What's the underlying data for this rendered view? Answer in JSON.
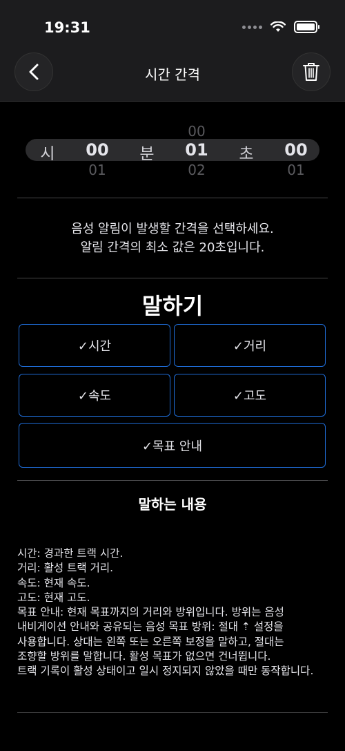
{
  "status_bar": {
    "time": "19:31"
  },
  "nav": {
    "title": "시간 간격"
  },
  "picker": {
    "hours": {
      "above": "",
      "value": "00",
      "below": "01",
      "unit": "시"
    },
    "minutes": {
      "above": "00",
      "value": "01",
      "below": "02",
      "unit": "분"
    },
    "seconds": {
      "above": "",
      "value": "00",
      "below": "01",
      "unit": "초"
    }
  },
  "description": {
    "line1": "음성 알림이 발생할 간격을 선택하세요.",
    "line2": "알림 간격의 최소 값은 20초입니다."
  },
  "speak": {
    "title": "말하기",
    "options": {
      "time": "✓시간",
      "distance": "✓거리",
      "speed": "✓속도",
      "altitude": "✓고도",
      "target": "✓목표 안내"
    }
  },
  "content": {
    "title": "말하는 내용",
    "lines": [
      "시간: 경과한 트랙 시간.",
      "거리: 활성 트랙 거리.",
      "속도: 현재 속도.",
      "고도: 현재 고도.",
      "목표 안내: 현재 목표까지의 거리와 방위입니다. 방위는 음성",
      "내비게이션 안내와 공유되는 음성 목표 방위: 절대 ⇡ 설정을",
      "사용합니다. 상대는 왼쪽 또는 오른쪽 보정을 말하고, 절대는",
      "조향할 방위를 말합니다. 활성 목표가 없으면 건너뜁니다.",
      "트랙 기록이 활성 상태이고 일시 정지되지 않았을 때만 동작합니다."
    ]
  }
}
